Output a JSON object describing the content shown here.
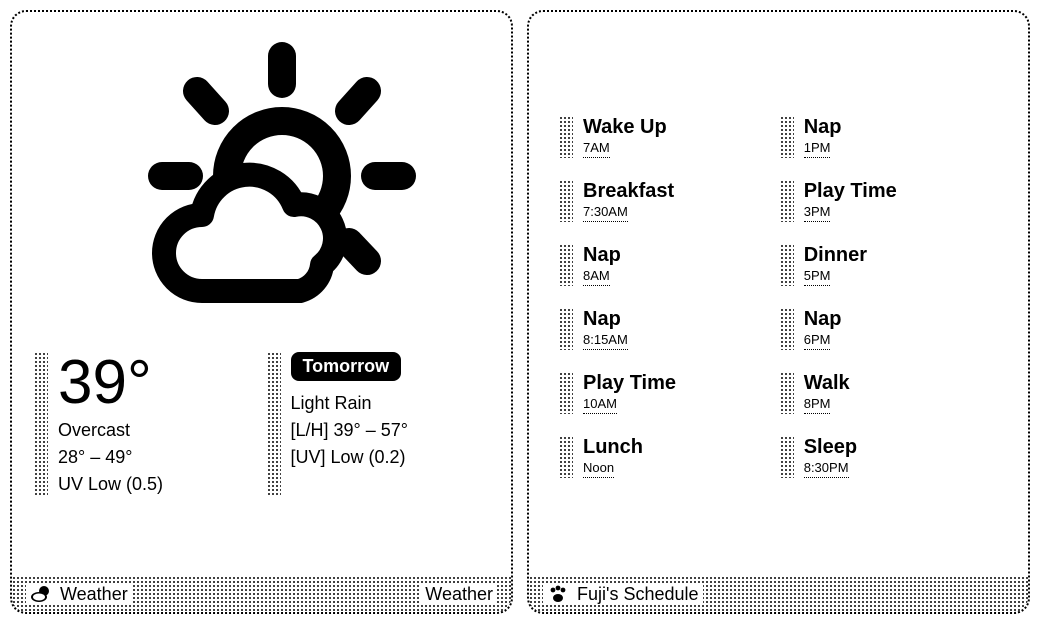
{
  "weather": {
    "footer_left": "Weather",
    "footer_right": "Weather",
    "today": {
      "temperature": "39°",
      "condition": "Overcast",
      "range": "28° – 49°",
      "uv": "UV Low (0.5)"
    },
    "tomorrow": {
      "label": "Tomorrow",
      "condition": "Light Rain",
      "range": "[L/H] 39° – 57°",
      "uv": "[UV] Low (0.2)"
    }
  },
  "schedule": {
    "footer_left": "Fuji's Schedule",
    "items": [
      {
        "label": "Wake Up",
        "time": "7AM"
      },
      {
        "label": "Breakfast",
        "time": "7:30AM"
      },
      {
        "label": "Nap",
        "time": "8AM"
      },
      {
        "label": "Nap",
        "time": "8:15AM"
      },
      {
        "label": "Play Time",
        "time": "10AM"
      },
      {
        "label": "Lunch",
        "time": "Noon"
      },
      {
        "label": "Nap",
        "time": "1PM"
      },
      {
        "label": "Play Time",
        "time": "3PM"
      },
      {
        "label": "Dinner",
        "time": "5PM"
      },
      {
        "label": "Nap",
        "time": "6PM"
      },
      {
        "label": "Walk",
        "time": "8PM"
      },
      {
        "label": "Sleep",
        "time": "8:30PM"
      }
    ]
  }
}
